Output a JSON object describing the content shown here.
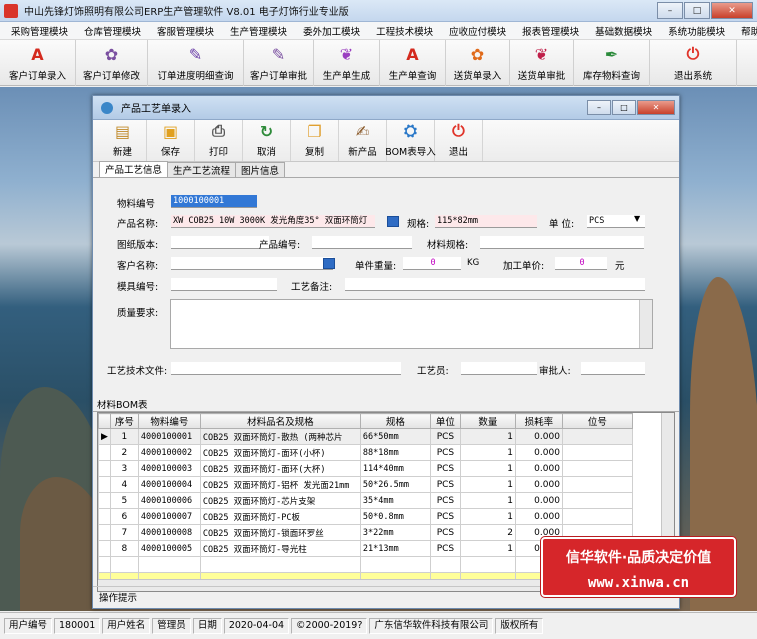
{
  "app": {
    "title": "中山先锋灯饰照明有限公司ERP生产管理软件 V8.01 电子灯饰行业专业版"
  },
  "window_controls": {
    "minimize": "–",
    "maximize": "□",
    "close": "✕"
  },
  "menu": [
    "采购管理模块",
    "仓库管理模块",
    "客服管理模块",
    "生产管理模块",
    "委外加工模块",
    "工程技术模块",
    "应收应付模块",
    "报表管理模块",
    "基础数据模块",
    "系统功能模块",
    "帮助"
  ],
  "toolbar": [
    {
      "label": "客户订单录入",
      "icon": "pdf-icon",
      "color": "#d42a1e",
      "glyph": "A"
    },
    {
      "label": "客户订单修改",
      "icon": "flower-icon",
      "color": "#7a4fa0",
      "glyph": "✿"
    },
    {
      "label": "订单进度明细查询",
      "icon": "pen-icon",
      "color": "#6b3fa8",
      "glyph": "✎"
    },
    {
      "label": "客户订单审批",
      "icon": "pen-icon",
      "color": "#7a4fa0",
      "glyph": "✎"
    },
    {
      "label": "生产单生成",
      "icon": "leaf-icon",
      "color": "#9a3ec0",
      "glyph": "❦"
    },
    {
      "label": "生产单查询",
      "icon": "pdf-icon",
      "color": "#d42a1e",
      "glyph": "A"
    },
    {
      "label": "送货单录入",
      "icon": "flower-icon",
      "color": "#e06a1a",
      "glyph": "✿"
    },
    {
      "label": "送货单审批",
      "icon": "leaf-icon",
      "color": "#c0204a",
      "glyph": "❦"
    },
    {
      "label": "库存物料查询",
      "icon": "feather-icon",
      "color": "#2a8a3a",
      "glyph": "✒"
    },
    {
      "label": "退出系统",
      "icon": "power-icon",
      "color": "#e0342a",
      "glyph": "⏻"
    }
  ],
  "child": {
    "title": "产品工艺单录入",
    "controls": {
      "minimize": "–",
      "maximize": "□",
      "close": "✕"
    },
    "toolbar": [
      {
        "label": "新建",
        "icon": "clipboard-icon",
        "color": "#c08a2a",
        "glyph": "▤"
      },
      {
        "label": "保存",
        "icon": "floppy-icon",
        "color": "#e0a020",
        "glyph": "▣"
      },
      {
        "label": "打印",
        "icon": "printer-icon",
        "color": "#555555",
        "glyph": "⎙"
      },
      {
        "label": "取消",
        "icon": "refresh-icon",
        "color": "#2e8b3a",
        "glyph": "↻"
      },
      {
        "label": "复制",
        "icon": "copy-icon",
        "color": "#e0a030",
        "glyph": "❐"
      },
      {
        "label": "新产品",
        "icon": "edit-icon",
        "color": "#8a5a2a",
        "glyph": "✍"
      },
      {
        "label": "BOM表导入",
        "icon": "import-icon",
        "color": "#2a78c8",
        "glyph": "⛭"
      },
      {
        "label": "退出",
        "icon": "power-icon",
        "color": "#e0342a",
        "glyph": "⏻"
      }
    ],
    "tabs": [
      "产品工艺信息",
      "生产工艺流程",
      "图片信息"
    ]
  },
  "form": {
    "material_no_label": "物料编号",
    "material_no": "1000100001",
    "product_name_label": "产品名称:",
    "product_name": "XW COB25 10W 3000K 发光角度35° 双面环筒灯",
    "spec_label": "规格:",
    "spec": "115*82mm",
    "unit_label": "单 位:",
    "unit": "PCS",
    "drawing_label": "图纸版本:",
    "drawing": "",
    "product_code_label": "产品编号:",
    "product_code": "",
    "material_spec_label": "材料规格:",
    "material_spec": "",
    "customer_label": "客户名称:",
    "customer": "",
    "weight_label": "单件重量:",
    "weight": "0",
    "weight_unit": "KG",
    "price_label": "加工单价:",
    "price": "0",
    "price_unit": "元",
    "mold_label": "模具编号:",
    "mold": "",
    "remark_label": "工艺备注:",
    "remark": "",
    "quality_label": "质量要求:",
    "tech_file_label": "工艺技术文件:",
    "engineer_label": "工艺员:",
    "approver_label": "审批人:"
  },
  "bom": {
    "label": "材料BOM表",
    "columns": [
      "序号",
      "物料编号",
      "材料品名及规格",
      "规格",
      "单位",
      "数量",
      "损耗率",
      "位号"
    ],
    "rows": [
      [
        "1",
        "4000100001",
        "COB25 双面环筒灯-散热 (两种芯片",
        "66*50mm",
        "PCS",
        "1",
        "0.000",
        ""
      ],
      [
        "2",
        "4000100002",
        "COB25 双面环筒灯-面环(小杯)",
        "88*18mm",
        "PCS",
        "1",
        "0.000",
        ""
      ],
      [
        "3",
        "4000100003",
        "COB25 双面环筒灯-面环(大杯)",
        "114*40mm",
        "PCS",
        "1",
        "0.000",
        ""
      ],
      [
        "4",
        "4000100004",
        "COB25 双面环筒灯-铝杯 发光面21mm",
        "50*26.5mm",
        "PCS",
        "1",
        "0.000",
        ""
      ],
      [
        "5",
        "4000100006",
        "COB25 双面环筒灯-芯片支架",
        "35*4mm",
        "PCS",
        "1",
        "0.000",
        ""
      ],
      [
        "6",
        "4000100007",
        "COB25 双面环筒灯-PC板",
        "50*0.8mm",
        "PCS",
        "1",
        "0.000",
        ""
      ],
      [
        "7",
        "4000100008",
        "COB25 双面环筒灯-锁面环罗丝",
        "3*22mm",
        "PCS",
        "2",
        "0.000",
        ""
      ],
      [
        "8",
        "4000100005",
        "COB25 双面环筒灯-导光柱",
        "21*13mm",
        "PCS",
        "1",
        "0.000",
        ""
      ]
    ]
  },
  "ops_label": "操作提示",
  "promo": {
    "line1": "信华软件·品质决定价值",
    "line2": "www.xinwa.cn"
  },
  "status": [
    "用户编号",
    "180001",
    "用户姓名",
    "管理员",
    "日期",
    "2020-04-04",
    "©2000-2019?",
    "广东信华软件科技有限公司",
    "版权所有"
  ]
}
